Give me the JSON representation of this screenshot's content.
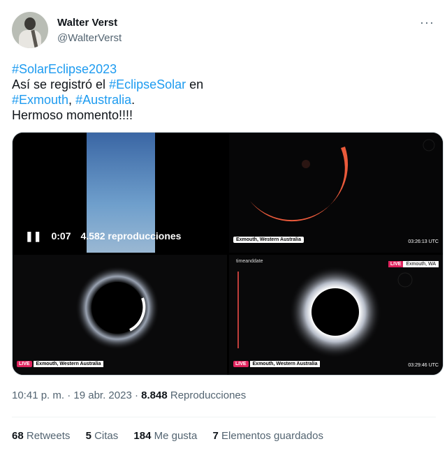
{
  "author": {
    "name": "Walter Verst",
    "handle": "@WalterVerst"
  },
  "tweet": {
    "hashtag1": "#SolarEclipse2023",
    "line2_prefix": "Así se registró el ",
    "hashtag2": "#EclipseSolar",
    "line2_suffix": " en",
    "hashtag3": "#Exmouth",
    "comma": ", ",
    "hashtag4": "#Australia",
    "period": ".",
    "line4": "Hermoso momento!!!!"
  },
  "video": {
    "time": "0:07",
    "views": "4.582 reproducciones"
  },
  "media_overlays": {
    "loc1": "Exmouth, Western Australia",
    "utc1": "03:26:13 UTC",
    "loc2": "Exmouth, Western Australia",
    "loc3": "Exmouth, Western Australia",
    "utc3": "03:29:46 UTC",
    "live_label": "LIVE",
    "logo": "timeanddate",
    "live_badge": "Exmouth, WA"
  },
  "meta": {
    "time": "10:41 p. m.",
    "sep1": " · ",
    "date": "19 abr. 2023",
    "sep2": " · ",
    "views_count": "8.848",
    "views_label": " Reproducciones"
  },
  "stats": {
    "retweets_count": "68",
    "retweets_label": " Retweets",
    "quotes_count": "5",
    "quotes_label": " Citas",
    "likes_count": "184",
    "likes_label": " Me gusta",
    "bookmarks_count": "7",
    "bookmarks_label": " Elementos guardados"
  },
  "colors": {
    "link": "#1d9bf0",
    "muted": "#536471"
  }
}
